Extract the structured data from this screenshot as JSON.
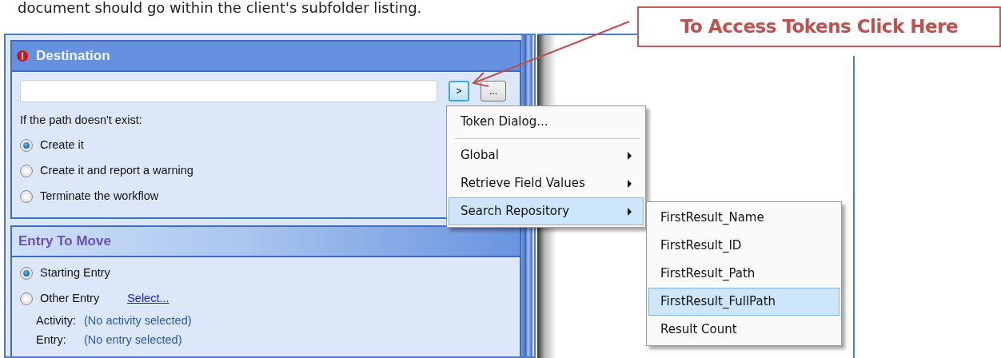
{
  "caption": "document should go within the client's subfolder listing.",
  "callout": {
    "text": "To Access Tokens Click Here"
  },
  "destination": {
    "title": "Destination",
    "error": true,
    "token_button": ">",
    "browse_button": "...",
    "prompt": "If the path doesn't exist:",
    "options": [
      {
        "label": "Create it",
        "selected": true
      },
      {
        "label": "Create it and report a warning",
        "selected": false
      },
      {
        "label": "Terminate the workflow",
        "selected": false
      }
    ]
  },
  "entry_to_move": {
    "title": "Entry To Move",
    "options": [
      {
        "label": "Starting Entry",
        "selected": true
      },
      {
        "label": "Other Entry",
        "selected": false,
        "link": "Select..."
      }
    ],
    "details": [
      {
        "label": "Activity:",
        "value": "(No activity selected)"
      },
      {
        "label": "Entry:",
        "value": "(No entry selected)"
      }
    ]
  },
  "token_menu": {
    "items": [
      {
        "kind": "command",
        "label": "Token Dialog...",
        "selected": false,
        "separator_after": true
      },
      {
        "kind": "submenu",
        "label": "Global",
        "selected": false
      },
      {
        "kind": "submenu",
        "label": "Retrieve Field Values",
        "selected": false
      },
      {
        "kind": "submenu",
        "label": "Search Repository",
        "selected": true
      }
    ]
  },
  "submenu": {
    "items": [
      {
        "label": "FirstResult_Name",
        "selected": false
      },
      {
        "label": "FirstResult_ID",
        "selected": false
      },
      {
        "label": "FirstResult_Path",
        "selected": false
      },
      {
        "label": "FirstResult_FullPath",
        "selected": true
      },
      {
        "label": "Result Count",
        "selected": false
      }
    ]
  }
}
